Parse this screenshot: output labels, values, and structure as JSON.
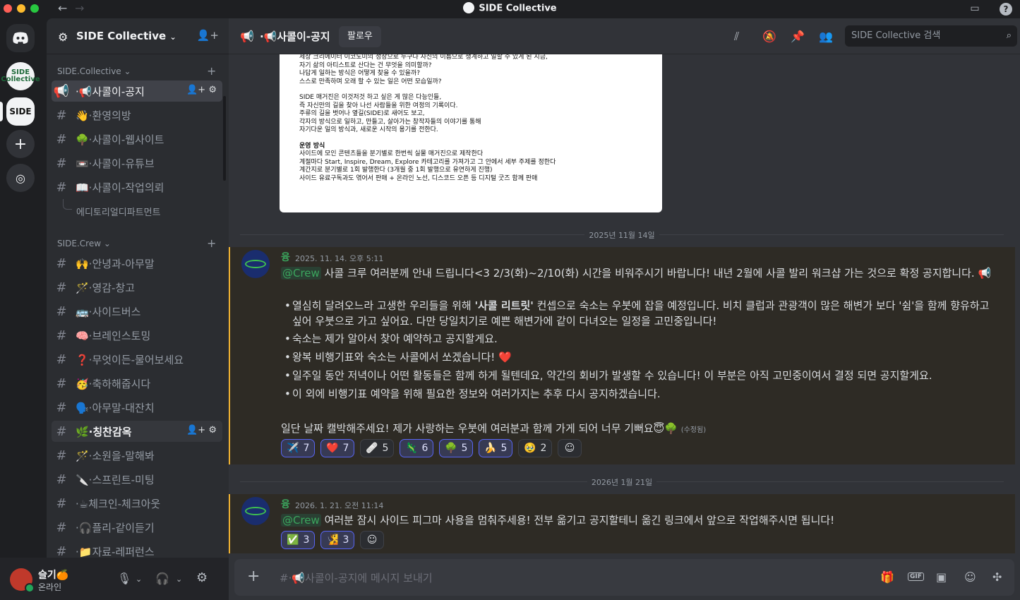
{
  "window": {
    "title": "SIDE Collective"
  },
  "servers": {
    "collective_label": "SIDE Collective",
    "side_label": "SIDE"
  },
  "server": {
    "name": "SIDE Collective"
  },
  "categories": [
    {
      "name": "SIDE.Collective"
    },
    {
      "name": "SIDE.Crew"
    }
  ],
  "channels_collective": [
    {
      "label": "·📢사콜이-공지"
    },
    {
      "label": "👋·환영의방"
    },
    {
      "label": "🌳·사콜이-웹사이트"
    },
    {
      "label": "📼·사콜이-유튜브"
    },
    {
      "label": "📖·사콜이-작업의뢰"
    }
  ],
  "subthread": {
    "label": "에디토리얼디파트먼트"
  },
  "channels_crew": [
    {
      "label": "🙌·안녕과-아무말"
    },
    {
      "label": "🪄·영감-창고"
    },
    {
      "label": "🚌·사이드버스"
    },
    {
      "label": "🧠·브레인스토밍"
    },
    {
      "label": "❓·무엇이든-물어보세요"
    },
    {
      "label": "🥳·축하해줍시다"
    },
    {
      "label": "🗣️·아무말-대잔치"
    },
    {
      "label": "🌿·칭찬감옥"
    },
    {
      "label": "🪄·소원을-말해봐"
    },
    {
      "label": "🔪·스프린트-미팅"
    },
    {
      "label": "·☕체크인-체크아웃"
    },
    {
      "label": "·🎧플리-같이듣기"
    },
    {
      "label": "·📁자료-레퍼런스"
    }
  ],
  "user": {
    "name": "슬기🍊",
    "status": "온라인"
  },
  "header": {
    "channel": "·📢사콜이-공지",
    "follow": "팔로우",
    "search_placeholder": "SIDE Collective 검색"
  },
  "document": {
    "lines_a": [
      "세상 크리에이터 이코노미의 성장으로 누구나 자신의 이름으로 생계하고 일할 수 있게 된 지금,",
      "자기 삶의 아티스트로 산다는 건 무엇을 의미할까?",
      "나답게 일하는 방식은 어떻게 찾을 수 있을까?",
      "스스로 만족하며 오래 할 수 있는 일은 어떤 모습일까?"
    ],
    "lines_b": [
      "SIDE 매거진은 이것저것 하고 싶은 게 많은 다능인들,",
      "즉 자신만의 길을 찾아 나선 사람들을 위한 여정의 기록이다.",
      "주류의 길을 벗어나 옆길(SIDE)로 새어도 보고,",
      "각자의 방식으로 일하고, 만들고, 살아가는 창작자들의 이야기를 통해",
      "자기다운 일의 방식과, 새로운 시작의 용기를 전한다."
    ],
    "ops_title": "운영 방식",
    "lines_c": [
      "사이드에 모인 콘텐츠들을 분기별로 한번씩 실물 매거진으로 제작한다",
      "계절마다 Start, Inspire, Dream, Explore 카테고리를 가져가고 그 안에서 세부 주제를 정한다",
      "계간지로 분기별로 1회 발행한다 (3개월 중 1회 발행으로 유연하게 진행)",
      "사이드 유료구독과도 엮어서 판매 + 온라인 노선, 디스코드 오픈 등 디지털 굿즈 함께 판매"
    ]
  },
  "dividers": [
    "2025년 11월 14일",
    "2026년 1월 21일"
  ],
  "messages": [
    {
      "author": "융",
      "time": "2025. 11. 14. 오후 5:11",
      "mention": "@Crew",
      "intro": " 사콜 크루 여러분께 안내 드립니다<3 2/3(화)~2/10(화) 시간을 비워주시기 바랍니다! 내년 2월에 사콜 발리 워크샵 가는 것으로 확정 공지합니다. 📢",
      "b1_pre": "열심히 달려오느라 고생한 우리들을 위해 ",
      "b1_bold": "'사콜 리트릿'",
      "b1_post": " 컨셉으로 숙소는 우붓에 잡을 예정입니다. 비치 클럽과 관광객이 많은 해변가 보다 '쉼'을 함께 향유하고 싶어 우붓으로 가고 싶어요. 다만 당일치기로 예쁜 해변가에 같이 다녀오는 일정을 고민중입니다!",
      "b2": "숙소는 제가 알아서 찾아 예약하고 공지할게요.",
      "b3": "왕복 비행기표와 숙소는 사콜에서 쏘겠습니다! ❤️",
      "b4": "일주일 동안 저녁이나 어떤 활동들은 함께 하게 될텐데요, 약간의 회비가 발생할 수 있습니다! 이 부분은 아직 고민중이여서 결정 되면 공지할게요.",
      "b5": "이 외에 비행기표 예약을 위해 필요한 정보와 여러가지는 추후 다시 공지하겠습니다.",
      "closing": "일단 날짜 캘박해주세요! 제가 사랑하는 우붓에 여러분과 함께 가게 되어 너무 기뻐요😇🌳",
      "edited": "(수정됨)",
      "reactions": [
        {
          "emoji": "✈️",
          "count": "7"
        },
        {
          "emoji": "❤️",
          "count": "7"
        },
        {
          "emoji": "🩹",
          "count": "5"
        },
        {
          "emoji": "🦎",
          "count": "6"
        },
        {
          "emoji": "🌳",
          "count": "5"
        },
        {
          "emoji": "🍌",
          "count": "5"
        },
        {
          "emoji": "🥹",
          "count": "2"
        }
      ]
    },
    {
      "author": "융",
      "time": "2026. 1. 21. 오전 11:14",
      "mention": "@Crew",
      "text": " 여러분 잠시 사이드 피그마 사용을 멈춰주세용! 전부 옮기고 공지할테니 옮긴 링크에서 앞으로 작업해주시면 됩니다!",
      "reactions": [
        {
          "emoji": "✅",
          "count": "3"
        },
        {
          "emoji": "🧏",
          "count": "3"
        }
      ]
    }
  ],
  "composer": {
    "placeholder": "#·📢사콜이-공지에 메시지 보내기"
  },
  "icons": {
    "composer": [
      "gift-icon",
      "gif-icon",
      "sticker-icon",
      "emoji-icon",
      "apps-icon"
    ],
    "header": [
      "threads-icon",
      "mute-icon",
      "pin-icon",
      "members-icon"
    ]
  },
  "colors": {
    "mention_highlight": "#2e2b25",
    "mention_bar": "#f0b232",
    "author": "#3ba55d"
  }
}
